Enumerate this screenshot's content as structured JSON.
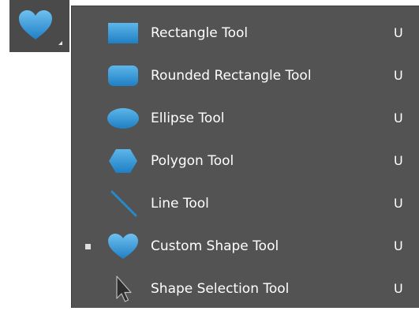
{
  "tool_button": {
    "icon": "heart-icon",
    "has_flyout_arrow": true
  },
  "colors": {
    "menu_bg": "#535353",
    "icon_blue": "#2f8fce",
    "text": "#ffffff"
  },
  "menu": {
    "items": [
      {
        "label": "Rectangle Tool",
        "shortcut": "U",
        "icon": "rectangle-icon",
        "selected": false
      },
      {
        "label": "Rounded Rectangle Tool",
        "shortcut": "U",
        "icon": "rounded-rectangle-icon",
        "selected": false
      },
      {
        "label": "Ellipse Tool",
        "shortcut": "U",
        "icon": "ellipse-icon",
        "selected": false
      },
      {
        "label": "Polygon Tool",
        "shortcut": "U",
        "icon": "polygon-icon",
        "selected": false
      },
      {
        "label": "Line Tool",
        "shortcut": "U",
        "icon": "line-icon",
        "selected": false
      },
      {
        "label": "Custom Shape Tool",
        "shortcut": "U",
        "icon": "heart-icon",
        "selected": true
      },
      {
        "label": "Shape Selection Tool",
        "shortcut": "U",
        "icon": "arrow-cursor-icon",
        "selected": false
      }
    ]
  }
}
